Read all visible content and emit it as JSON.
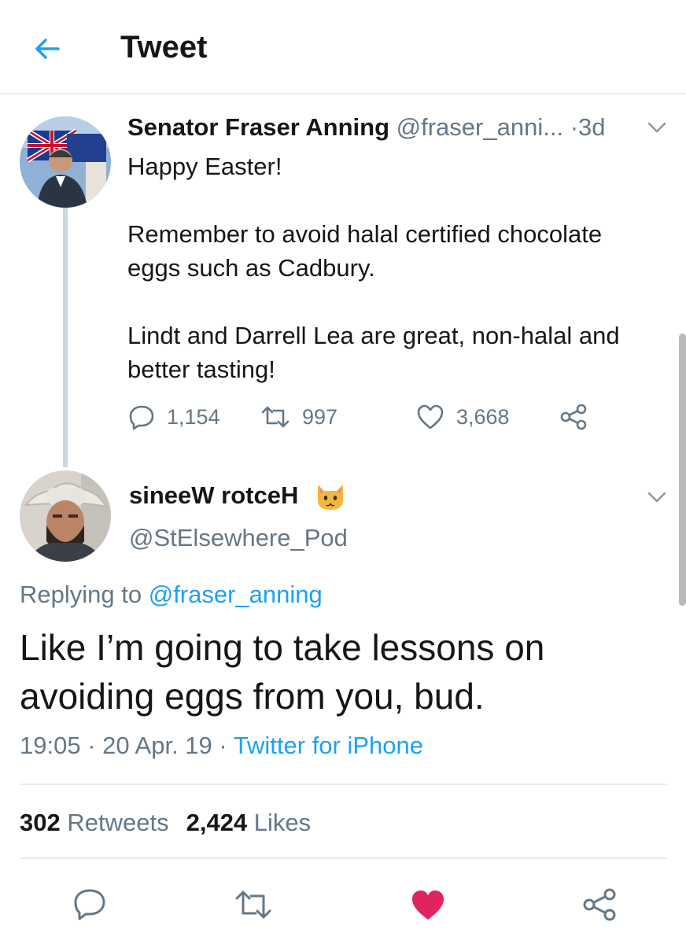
{
  "header": {
    "title": "Tweet",
    "back_icon": "arrow-left-icon"
  },
  "parent_tweet": {
    "author_name": "Senator Fraser Anning",
    "author_handle": "@fraser_anni...",
    "separator": "·",
    "time": "3d",
    "lines": [
      "Happy Easter!",
      "Remember to avoid halal certified chocolate",
      "eggs such as Cadbury.",
      "Lindt and Darrell Lea are great, non-halal and",
      "better tasting!"
    ],
    "replies": "1,154",
    "retweets": "997",
    "likes": "3,668"
  },
  "reply_tweet": {
    "author_name": "sineeW rotceH",
    "author_emoji": "cat-face-emoji",
    "author_handle": "@StElsewhere_Pod",
    "replying_prefix": "Replying to",
    "replying_to": "@fraser_anning",
    "text_line1": "Like I’m going to take lessons on",
    "text_line2": "avoiding eggs from you, bud.",
    "time": "19:05",
    "date": "20 Apr. 19",
    "source": "Twitter for iPhone",
    "retweet_count": "302",
    "retweet_label": "Retweets",
    "like_count": "2,424",
    "like_label": "Likes"
  },
  "colors": {
    "accent": "#1da1f2",
    "muted": "#657786",
    "text": "#14171a",
    "like_active": "#e0245e",
    "divider": "#e6ecf0"
  }
}
